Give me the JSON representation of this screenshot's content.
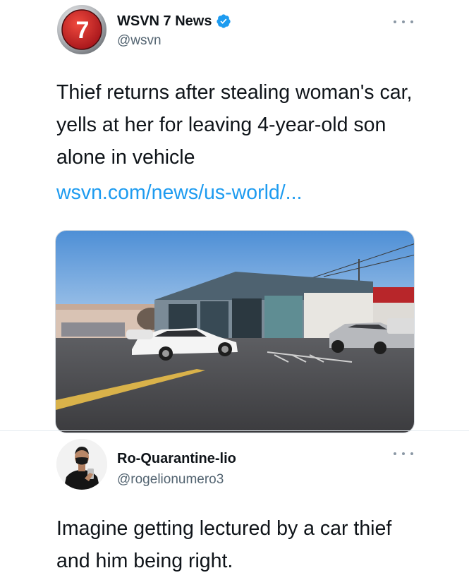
{
  "tweet": {
    "author": {
      "name": "WSVN 7 News",
      "handle": "@wsvn",
      "verified": true,
      "avatar_icon": "wsvn-7-logo",
      "avatar_logo_text": "7"
    },
    "text": "Thief returns after stealing woman's car, yells at her for leaving 4-year-old son alone in vehicle",
    "link": "wsvn.com/news/us-world/...",
    "more_icon": "more-horizontal-icon",
    "media": {
      "description_icon": "news-photo"
    }
  },
  "reply": {
    "author": {
      "name": "Ro-Quarantine-lio",
      "handle": "@rogelionumero3",
      "avatar_icon": "user-avatar-photo"
    },
    "text": "Imagine getting lectured by a car thief and him being right.",
    "more_icon": "more-horizontal-icon"
  },
  "colors": {
    "link": "#1d9bf0",
    "verified": "#1d9bf0",
    "text": "#0f1419",
    "secondary": "#536471",
    "logo_red": "#d51f26"
  }
}
